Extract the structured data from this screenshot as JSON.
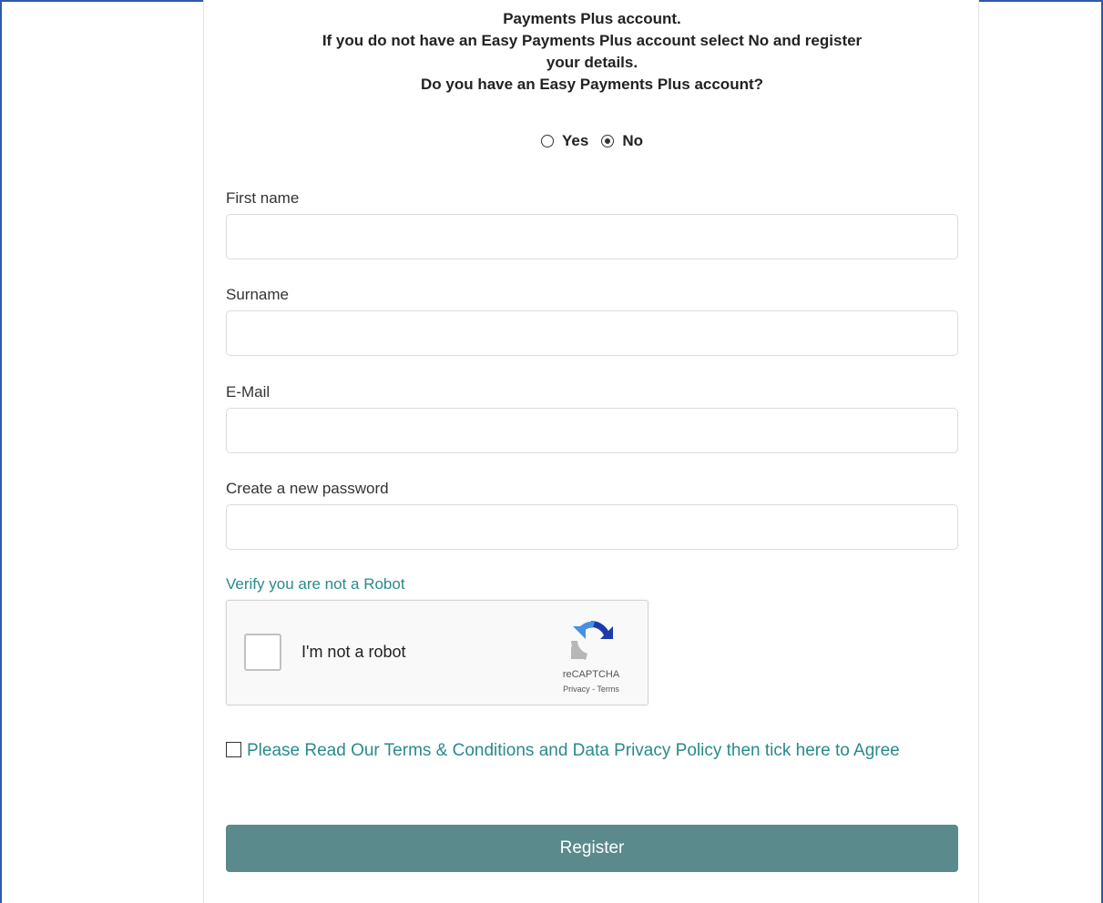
{
  "intro": {
    "line1": "Payments Plus account.",
    "line2": "If you do not have an Easy Payments Plus account select No and register",
    "line3": "your details.",
    "question": "Do you have an Easy Payments Plus account?"
  },
  "account_choice": {
    "yes_label": "Yes",
    "no_label": "No",
    "selected": "No"
  },
  "fields": {
    "first_name": {
      "label": "First name",
      "value": ""
    },
    "surname": {
      "label": "Surname",
      "value": ""
    },
    "email": {
      "label": "E-Mail",
      "value": ""
    },
    "password": {
      "label": "Create a new password",
      "value": ""
    }
  },
  "captcha": {
    "heading": "Verify you are not a Robot",
    "checkbox_label": "I'm not a robot",
    "brand": "reCAPTCHA",
    "links": "Privacy - Terms",
    "colors": {
      "blue": "#1c3aa9",
      "light_blue": "#4a90e2",
      "grey": "#b7b7b7"
    }
  },
  "terms": {
    "label": "Please Read Our Terms & Conditions and Data Privacy Policy then tick here to Agree",
    "checked": false
  },
  "register_label": "Register",
  "colors": {
    "accent_text": "#2a8a8a",
    "button": "#5a8a8c",
    "frame": "#2f5aa8"
  }
}
